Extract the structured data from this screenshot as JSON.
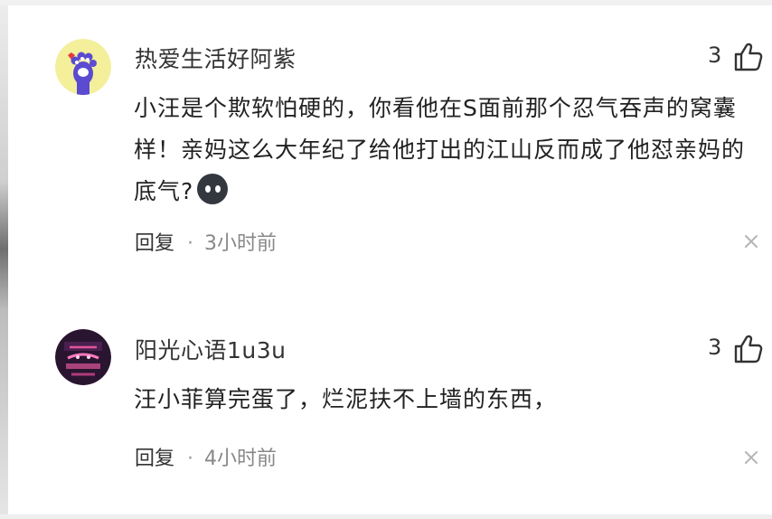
{
  "comments": [
    {
      "username": "热爱生活好阿紫",
      "text": "小汪是个欺软怕硬的，你看他在S面前那个忍气吞声的窝囊样！亲妈这么大年纪了给他打出的江山反而成了他怼亲妈的底气?",
      "emoji": "emoji-face-icon",
      "likes": "3",
      "reply_label": "回复",
      "separator": "·",
      "time": "3小时前"
    },
    {
      "username": "阳光心语1u3u",
      "text": "汪小菲算完蛋了，烂泥扶不上墙的东西，",
      "likes": "3",
      "reply_label": "回复",
      "separator": "·",
      "time": "4小时前"
    }
  ],
  "colors": {
    "text": "#222222",
    "meta": "#888888",
    "avatar1_bg": "#f3ef9b",
    "avatar1_paw": "#5b4bd1",
    "avatar2_bg": "#2a1530",
    "avatar2_accent": "#e0559a"
  },
  "icons": [
    "avatar-paw",
    "avatar-neon",
    "thumbs-up-icon",
    "close-icon",
    "emoji-face-icon"
  ]
}
